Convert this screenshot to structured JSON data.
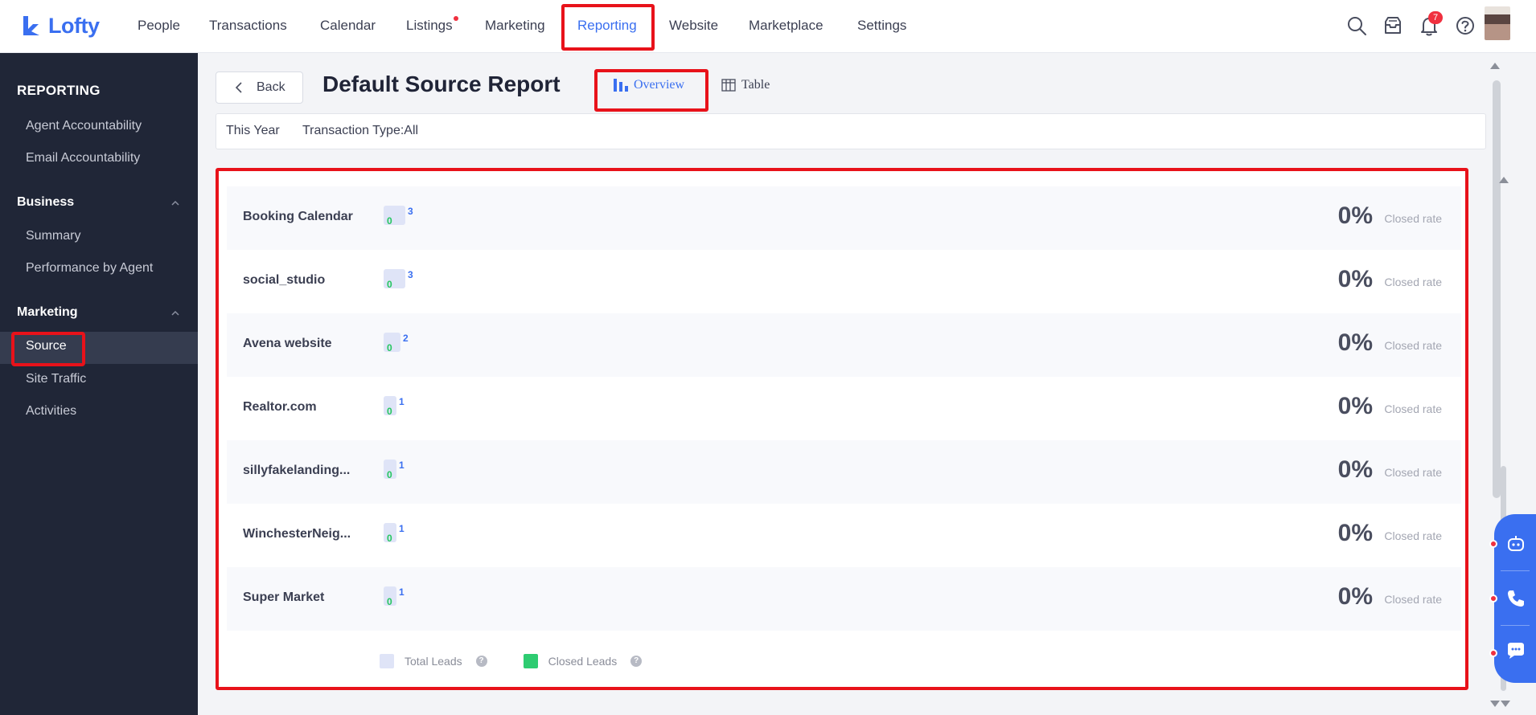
{
  "app": {
    "logo_text": "Lofty"
  },
  "topnav": {
    "items": [
      {
        "label": "People"
      },
      {
        "label": "Transactions"
      },
      {
        "label": "Calendar"
      },
      {
        "label": "Listings"
      },
      {
        "label": "Marketing"
      },
      {
        "label": "Reporting"
      },
      {
        "label": "Website"
      },
      {
        "label": "Marketplace"
      },
      {
        "label": "Settings"
      }
    ],
    "active": "Reporting",
    "notification_count": "7",
    "icons": [
      "search-icon",
      "inbox-icon",
      "bell-icon",
      "help-icon"
    ]
  },
  "sidebar": {
    "title": "REPORTING",
    "top_items": [
      {
        "label": "Agent Accountability"
      },
      {
        "label": "Email Accountability"
      }
    ],
    "groups": [
      {
        "label": "Business",
        "items": [
          {
            "label": "Summary"
          },
          {
            "label": "Performance by Agent"
          }
        ]
      },
      {
        "label": "Marketing",
        "items": [
          {
            "label": "Source"
          },
          {
            "label": "Site Traffic"
          },
          {
            "label": "Activities"
          }
        ]
      }
    ],
    "active_item": "Source"
  },
  "header": {
    "back_label": "Back",
    "title": "Default Source Report",
    "tabs": [
      {
        "label": "Overview"
      },
      {
        "label": "Table"
      }
    ],
    "active_tab": "Overview"
  },
  "filters": {
    "period": "This Year",
    "transaction_type": "Transaction Type:All"
  },
  "chart_data": {
    "type": "bar",
    "categories": [
      "Booking Calendar",
      "social_studio",
      "Avena website",
      "Realtor.com",
      "sillyfakelanding...",
      "WinchesterNeig...",
      "Super Market"
    ],
    "series": [
      {
        "name": "Total Leads",
        "values": [
          3,
          3,
          2,
          1,
          1,
          1,
          1
        ]
      },
      {
        "name": "Closed Leads",
        "values": [
          0,
          0,
          0,
          0,
          0,
          0,
          0
        ]
      }
    ],
    "closed_rate": [
      "0%",
      "0%",
      "0%",
      "0%",
      "0%",
      "0%",
      "0%"
    ],
    "closed_rate_label": "Closed rate",
    "legend": [
      {
        "label": "Total Leads",
        "color": "#dfe4f7"
      },
      {
        "label": "Closed Leads",
        "color": "#2ecc71"
      }
    ]
  },
  "colors": {
    "accent": "#3a6ff0",
    "highlight": "#e8121a",
    "sidebar_bg": "#202637",
    "closed_green": "#22c55e"
  }
}
